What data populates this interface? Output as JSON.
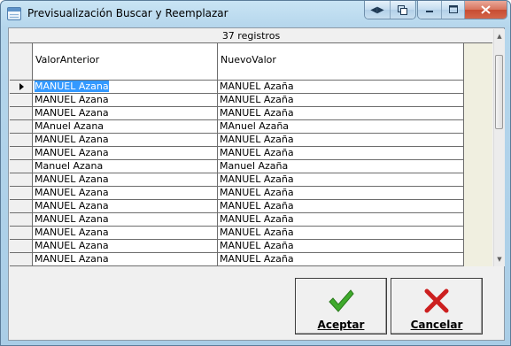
{
  "window": {
    "title": "Previsualización Buscar y Reemplazar"
  },
  "grid": {
    "caption": "37 registros",
    "columns": [
      "ValorAnterior",
      "NuevoValor"
    ],
    "rows": [
      [
        "MANUEL Azana",
        "MANUEL Azaña"
      ],
      [
        "MANUEL Azana",
        "MANUEL Azaña"
      ],
      [
        "MANUEL Azana",
        "MANUEL Azaña"
      ],
      [
        "MAnuel Azana",
        "MAnuel Azaña"
      ],
      [
        "MANUEL Azana",
        "MANUEL Azaña"
      ],
      [
        "MANUEL Azana",
        "MANUEL Azaña"
      ],
      [
        "Manuel Azana",
        "Manuel Azaña"
      ],
      [
        "MANUEL Azana",
        "MANUEL Azaña"
      ],
      [
        "MANUEL Azana",
        "MANUEL Azaña"
      ],
      [
        "MANUEL Azana",
        "MANUEL Azaña"
      ],
      [
        "MANUEL Azana",
        "MANUEL Azaña"
      ],
      [
        "MANUEL Azana",
        "MANUEL Azaña"
      ],
      [
        "MANUEL Azana",
        "MANUEL Azaña"
      ],
      [
        "MANUEL Azana",
        "MANUEL Azaña"
      ]
    ],
    "selected_row": 0
  },
  "buttons": {
    "accept": {
      "label": "Aceptar",
      "icon": "checkmark-icon",
      "color": "#3faa2c"
    },
    "cancel": {
      "label": "Cancelar",
      "icon": "x-mark-icon",
      "color": "#cc1f1f"
    }
  }
}
